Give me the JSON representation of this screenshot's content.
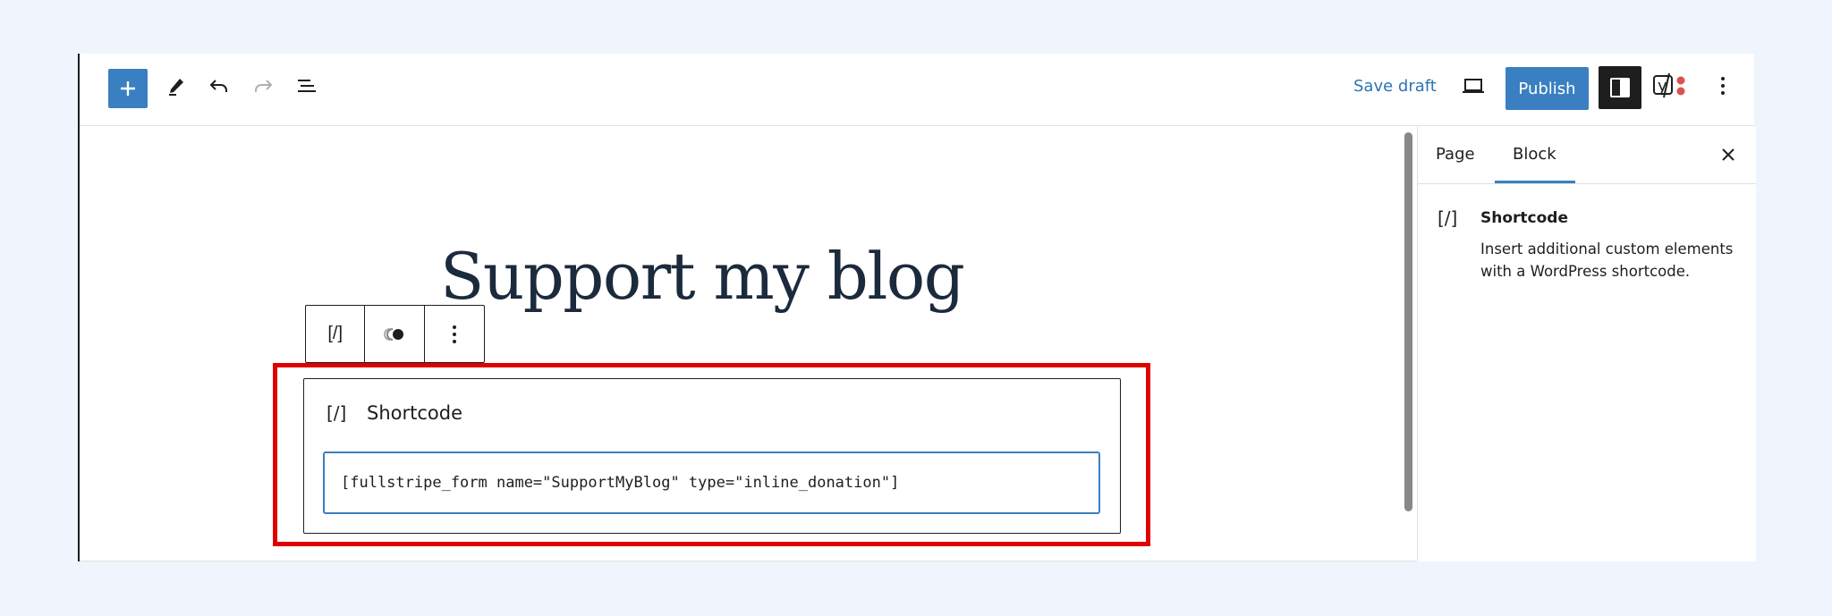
{
  "toolbar": {
    "inserter_icon": "plus-icon",
    "tools_icon": "pencil-icon",
    "undo_icon": "undo-icon",
    "redo_icon": "redo-icon",
    "list_view_icon": "list-view-icon",
    "save_draft_label": "Save draft",
    "preview_icon": "laptop-icon",
    "publish_label": "Publish",
    "settings_icon": "sidebar-toggle-icon",
    "yoast_icon": "yoast-icon",
    "more_icon": "more-vertical-icon"
  },
  "editor": {
    "page_title": "Support my blog",
    "block_toolbar": {
      "block_type_icon": "[/]",
      "transform_icon": "toggle-icon",
      "options_icon": "more-vertical-icon"
    },
    "shortcode_block": {
      "icon": "[/]",
      "label": "Shortcode",
      "value": "[fullstripe_form name=\"SupportMyBlog\" type=\"inline_donation\"]"
    }
  },
  "sidebar": {
    "tabs": [
      {
        "label": "Page",
        "active": false
      },
      {
        "label": "Block",
        "active": true
      }
    ],
    "block_card": {
      "icon": "[/]",
      "title": "Shortcode",
      "description": "Insert additional custom elements with a WordPress shortcode."
    }
  },
  "colors": {
    "accent": "#3a7fc1",
    "highlight": "#e00000"
  }
}
